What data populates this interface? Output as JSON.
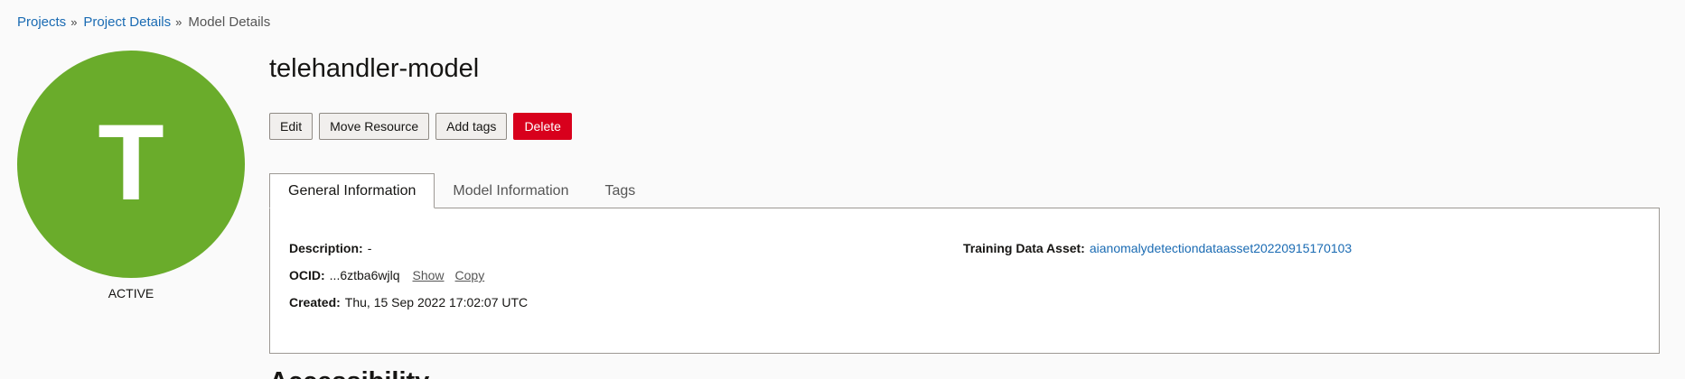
{
  "breadcrumb": {
    "items": [
      "Projects",
      "Project Details"
    ],
    "current": "Model Details",
    "separator": "»"
  },
  "avatar": {
    "letter": "T",
    "color": "#6aac2b",
    "status": "ACTIVE"
  },
  "title": "telehandler-model",
  "actions": {
    "edit": "Edit",
    "move": "Move Resource",
    "add_tags": "Add tags",
    "delete": "Delete"
  },
  "tabs": [
    "General Information",
    "Model Information",
    "Tags"
  ],
  "general_info": {
    "description_label": "Description:",
    "description_value": "-",
    "ocid_label": "OCID:",
    "ocid_value": "...6ztba6wjlq",
    "show_link": "Show",
    "copy_link": "Copy",
    "created_label": "Created:",
    "created_value": "Thu, 15 Sep 2022 17:02:07 UTC",
    "training_label": "Training Data Asset:",
    "training_value": "aianomalydetectiondataasset20220915170103"
  },
  "next_section_heading": "Accessibility"
}
